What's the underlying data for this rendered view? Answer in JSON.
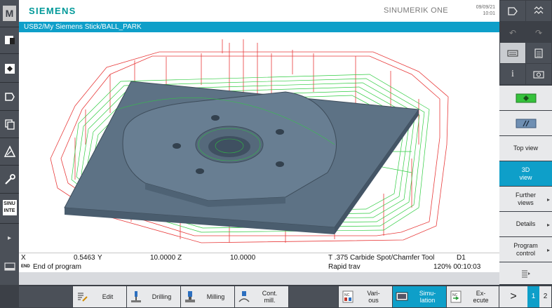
{
  "header": {
    "brand": "SIEMENS",
    "product": "SINUMERIK ONE",
    "date": "09/09/21",
    "time": "10:01"
  },
  "path": "USB2/My Siemens Stick/BALL_PARK",
  "coords": {
    "x_label": "X",
    "x_value": "0.5463",
    "y_label": "Y",
    "y_value": "10.0000",
    "z_label": "Z",
    "z_value": "10.0000",
    "tool": "T .375 Carbide Spot/Chamfer Tool",
    "edge": "D1"
  },
  "status": {
    "tag": "END",
    "message": "End of program",
    "feed": "Rapid trav",
    "override_time": "120% 00:10:03"
  },
  "left_toolbar": {
    "icons": [
      "machine-icon",
      "parameter-icon",
      "program-icon",
      "program-manager-icon",
      "diagnostics-icon",
      "alarm-triangle-icon",
      "setup-wrench-icon",
      "sinumerik-integrate-icon"
    ],
    "m_label": "M",
    "sinu_label": "SINU INTE"
  },
  "right_softkeys": {
    "top_view": "Top view",
    "view_3d_line1": "3D",
    "view_3d_line2": "view",
    "further_views_line1": "Further",
    "further_views_line2": "views",
    "details": "Details",
    "program_control_line1": "Program",
    "program_control_line2": "control"
  },
  "bottom_softkeys": {
    "edit": "Edit",
    "drilling": "Drilling",
    "milling": "Milling",
    "cont_mill_line1": "Cont.",
    "cont_mill_line2": "mill.",
    "various_line1": "Vari-",
    "various_line2": "ous",
    "simulation_line1": "Simu-",
    "simulation_line2": "lation",
    "execute_line1": "Ex-",
    "execute_line2": "ecute",
    "next": ">",
    "page1": "1",
    "page2": "2",
    "nc_badge": "NC"
  },
  "colors": {
    "accent": "#0e9fc9",
    "brand": "#009999",
    "rapid_path": "#e83a3a",
    "feed_path": "#2ecc40",
    "part": "#607890"
  }
}
